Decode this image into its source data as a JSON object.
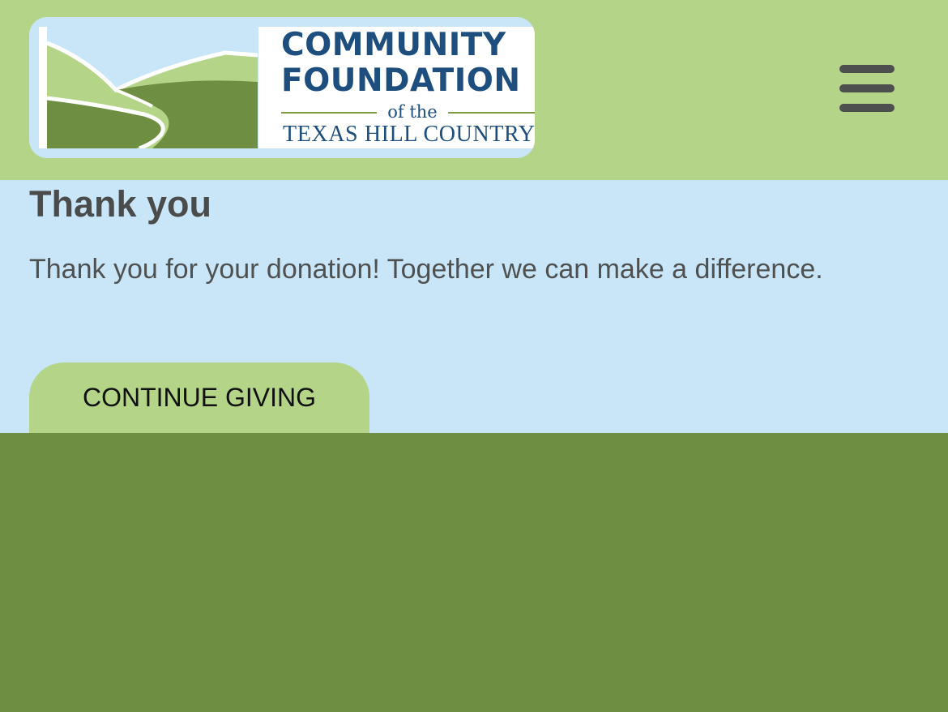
{
  "header": {
    "logo": {
      "line1": "COMMUNITY",
      "line2": "FOUNDATION",
      "of_the": "of the",
      "line3": "TEXAS HILL COUNTRY"
    },
    "menu_icon": "hamburger-menu-icon"
  },
  "main": {
    "title": "Thank you",
    "message": "Thank you for your donation! Together we can make a difference.",
    "continue_button": "CONTINUE GIVING"
  },
  "colors": {
    "header_bg": "#b4d487",
    "content_bg": "#c9e6f8",
    "footer_bg": "#6e8f41",
    "brand_blue": "#1d4e7e",
    "button_bg": "#b4d487"
  }
}
